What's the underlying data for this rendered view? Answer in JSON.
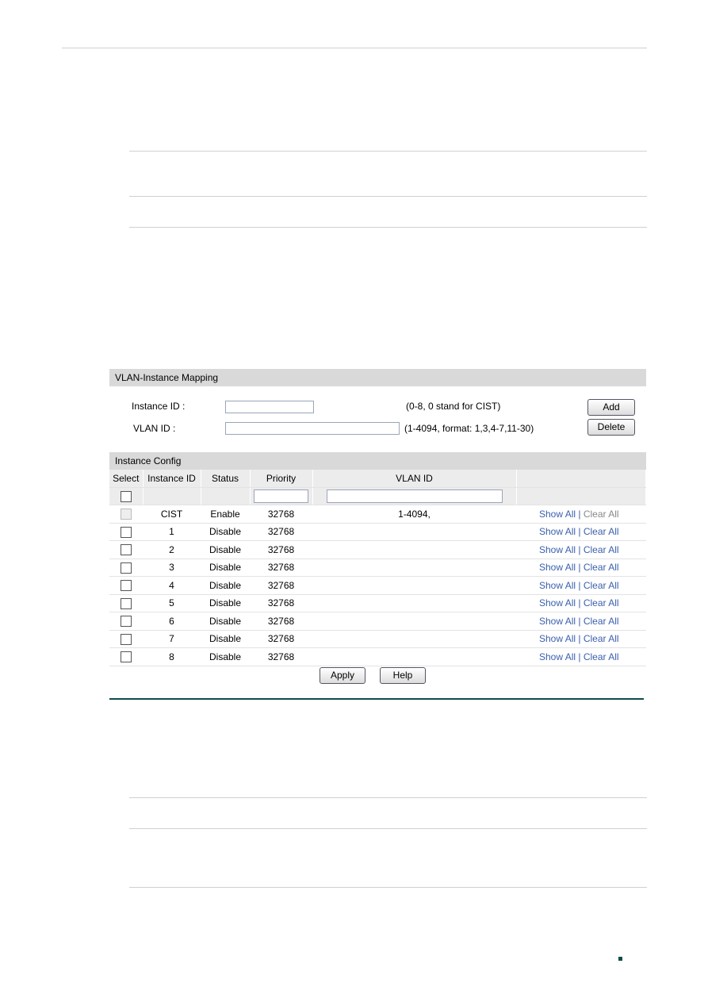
{
  "mapping": {
    "title": "VLAN-Instance Mapping",
    "instance_label": "Instance ID :",
    "instance_value": "",
    "instance_hint": "(0-8, 0 stand for CIST)",
    "vlan_label": "VLAN ID :",
    "vlan_value": "",
    "vlan_hint": "(1-4094, format: 1,3,4-7,11-30)",
    "add": "Add",
    "delete": "Delete"
  },
  "config": {
    "title": "Instance Config",
    "columns": [
      "Select",
      "Instance ID",
      "Status",
      "Priority",
      "VLAN ID",
      ""
    ],
    "rows": [
      {
        "id": "CIST",
        "status": "Enable",
        "priority": "32768",
        "vlan": "1-4094,"
      },
      {
        "id": "1",
        "status": "Disable",
        "priority": "32768",
        "vlan": ""
      },
      {
        "id": "2",
        "status": "Disable",
        "priority": "32768",
        "vlan": ""
      },
      {
        "id": "3",
        "status": "Disable",
        "priority": "32768",
        "vlan": ""
      },
      {
        "id": "4",
        "status": "Disable",
        "priority": "32768",
        "vlan": ""
      },
      {
        "id": "5",
        "status": "Disable",
        "priority": "32768",
        "vlan": ""
      },
      {
        "id": "6",
        "status": "Disable",
        "priority": "32768",
        "vlan": ""
      },
      {
        "id": "7",
        "status": "Disable",
        "priority": "32768",
        "vlan": ""
      },
      {
        "id": "8",
        "status": "Disable",
        "priority": "32768",
        "vlan": ""
      }
    ],
    "show_all": "Show All",
    "separator": "|",
    "clear_all": "Clear All",
    "apply": "Apply",
    "help": "Help"
  },
  "colors": {
    "link": "#3a5fad",
    "rule": "#0e4d4d"
  }
}
